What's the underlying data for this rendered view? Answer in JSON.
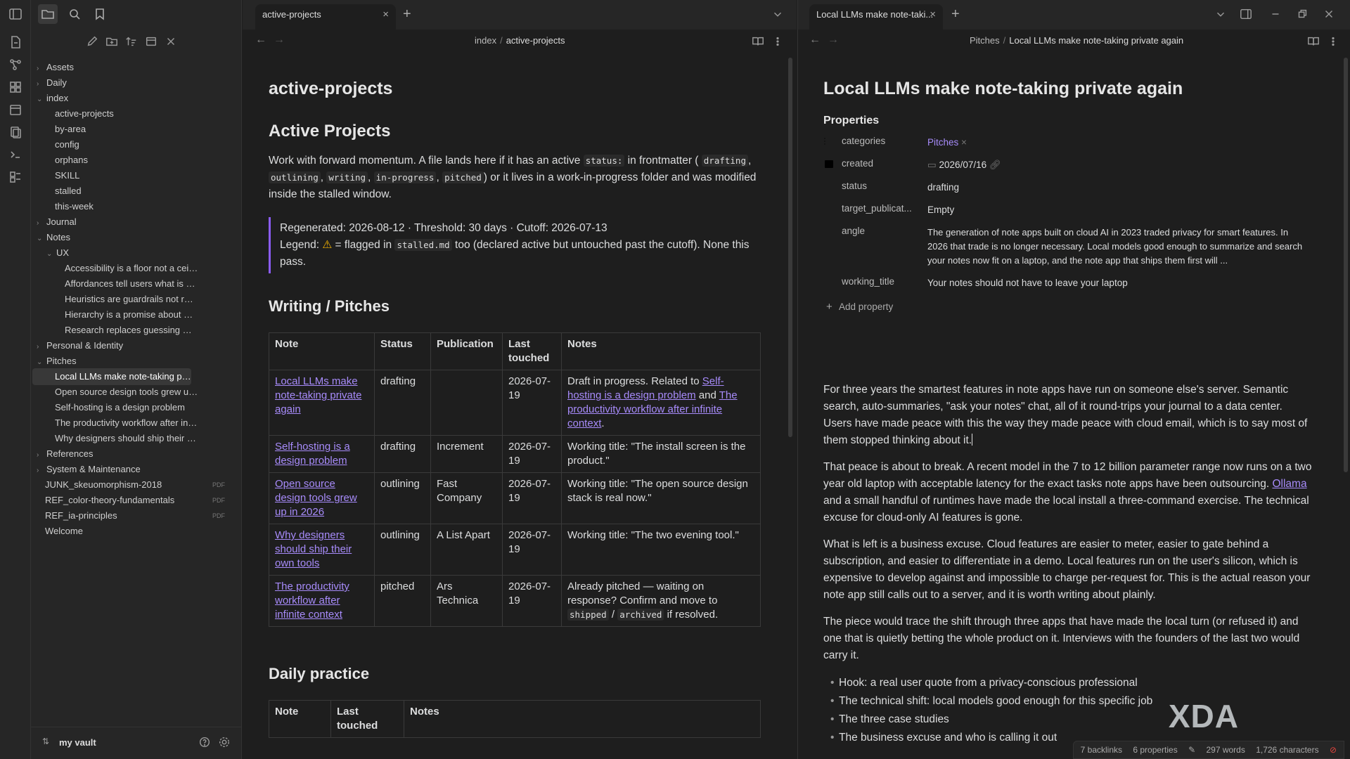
{
  "sidebar": {
    "tree": [
      {
        "label": "Assets",
        "kind": "folder",
        "open": false,
        "level": 0
      },
      {
        "label": "Daily",
        "kind": "folder",
        "open": false,
        "level": 0
      },
      {
        "label": "index",
        "kind": "folder",
        "open": true,
        "level": 0
      },
      {
        "label": "active-projects",
        "kind": "file",
        "level": 1
      },
      {
        "label": "by-area",
        "kind": "file",
        "level": 1
      },
      {
        "label": "config",
        "kind": "file",
        "level": 1
      },
      {
        "label": "orphans",
        "kind": "file",
        "level": 1
      },
      {
        "label": "SKILL",
        "kind": "file",
        "level": 1
      },
      {
        "label": "stalled",
        "kind": "file",
        "level": 1
      },
      {
        "label": "this-week",
        "kind": "file",
        "level": 1
      },
      {
        "label": "Journal",
        "kind": "folder",
        "open": false,
        "level": 0
      },
      {
        "label": "Notes",
        "kind": "folder",
        "open": true,
        "level": 0
      },
      {
        "label": "UX",
        "kind": "folder",
        "open": true,
        "level": 1
      },
      {
        "label": "Accessibility is a floor not a ceiling",
        "kind": "file",
        "level": 2
      },
      {
        "label": "Affordances tell users what is possi...",
        "kind": "file",
        "level": 2
      },
      {
        "label": "Heuristics are guardrails not rules",
        "kind": "file",
        "level": 2
      },
      {
        "label": "Hierarchy is a promise about what ...",
        "kind": "file",
        "level": 2
      },
      {
        "label": "Research replaces guessing with wi...",
        "kind": "file",
        "level": 2
      },
      {
        "label": "Personal & Identity",
        "kind": "folder",
        "open": false,
        "level": 0
      },
      {
        "label": "Pitches",
        "kind": "folder",
        "open": true,
        "level": 0
      },
      {
        "label": "Local LLMs make note-taking private ...",
        "kind": "file",
        "level": 1,
        "selected": true
      },
      {
        "label": "Open source design tools grew up in ...",
        "kind": "file",
        "level": 1
      },
      {
        "label": "Self-hosting is a design problem",
        "kind": "file",
        "level": 1
      },
      {
        "label": "The productivity workflow after infinit...",
        "kind": "file",
        "level": 1
      },
      {
        "label": "Why designers should ship their own ...",
        "kind": "file",
        "level": 1
      },
      {
        "label": "References",
        "kind": "folder",
        "open": false,
        "level": 0
      },
      {
        "label": "System & Maintenance",
        "kind": "folder",
        "open": false,
        "level": 0
      },
      {
        "label": "JUNK_skeuomorphism-2018",
        "kind": "file",
        "level": 0,
        "badge": "PDF"
      },
      {
        "label": "REF_color-theory-fundamentals",
        "kind": "file",
        "level": 0,
        "badge": "PDF"
      },
      {
        "label": "REF_ia-principles",
        "kind": "file",
        "level": 0,
        "badge": "PDF"
      },
      {
        "label": "Welcome",
        "kind": "file",
        "level": 0
      }
    ],
    "vault_name": "my vault"
  },
  "left_pane": {
    "tab_label": "active-projects",
    "breadcrumb": [
      "index",
      "active-projects"
    ],
    "inline_title": "active-projects",
    "h1": "Active Projects",
    "intro": {
      "t1": "Work with forward momentum. A file lands here if it has an active ",
      "c1": "status:",
      "t2": " in frontmatter (",
      "c2": "drafting",
      "c3": "outlining",
      "c4": "writing",
      "c5": "in-progress",
      "c6": "pitched",
      "t3": ") or it lives in a work-in-progress folder and was modified inside the stalled window."
    },
    "callout": {
      "line1": "Regenerated: 2026-08-12 · Threshold: 30 days · Cutoff: 2026-07-13",
      "legend_a": "Legend: ",
      "legend_b": " = flagged in ",
      "legend_code": "stalled.md",
      "legend_c": " too (declared active but untouched past the cutoff). None this pass."
    },
    "h2_writing": "Writing / Pitches",
    "table_headers": [
      "Note",
      "Status",
      "Publication",
      "Last touched",
      "Notes"
    ],
    "rows": [
      {
        "note": "Local LLMs make note-taking private again",
        "status": "drafting",
        "pub": "",
        "last": "2026-07-19",
        "notes_a": "Draft in progress. Related to ",
        "link1": "Self-hosting is a design problem",
        "notes_b": " and ",
        "link2": "The productivity workflow after infinite context",
        "notes_c": "."
      },
      {
        "note": "Self-hosting is a design problem",
        "status": "drafting",
        "pub": "Increment",
        "last": "2026-07-19",
        "notes": "Working title: \"The install screen is the product.\""
      },
      {
        "note": "Open source design tools grew up in 2026",
        "status": "outlining",
        "pub": "Fast Company",
        "last": "2026-07-19",
        "notes": "Working title: \"The open source design stack is real now.\""
      },
      {
        "note": "Why designers should ship their own tools",
        "status": "outlining",
        "pub": "A List Apart",
        "last": "2026-07-19",
        "notes": "Working title: \"The two evening tool.\""
      },
      {
        "note": "The productivity workflow after infinite context",
        "status": "pitched",
        "pub": "Ars Technica",
        "last": "2026-07-19",
        "notes_a": "Already pitched — waiting on response? Confirm and move to ",
        "code1": "shipped",
        "notes_b": " / ",
        "code2": "archived",
        "notes_c": " if resolved."
      }
    ],
    "h2_daily": "Daily practice",
    "daily_headers": [
      "Note",
      "Last touched",
      "Notes"
    ]
  },
  "right_pane": {
    "tab_label": "Local LLMs make note-taki...",
    "breadcrumb": [
      "Pitches",
      "Local LLMs make note-taking private again"
    ],
    "inline_title": "Local LLMs make note-taking private again",
    "properties_heading": "Properties",
    "properties": [
      {
        "name": "categories",
        "value": "Pitches",
        "icon": "list-icon"
      },
      {
        "name": "created",
        "value": "2026/07/16",
        "icon": "calendar-icon"
      },
      {
        "name": "status",
        "value": "drafting",
        "icon": "text-icon"
      },
      {
        "name": "target_publicat...",
        "value": "Empty",
        "icon": "text-icon"
      },
      {
        "name": "angle",
        "value": "The generation of note apps built on cloud AI in 2023 traded privacy for smart features. In 2026 that trade is no longer necessary. Local models good enough to summarize and search your notes now fit on a laptop, and the note app that ships them first will ...",
        "icon": "text-icon"
      },
      {
        "name": "working_title",
        "value": "Your notes should not have to leave your laptop",
        "icon": "text-icon"
      }
    ],
    "add_property": "Add property",
    "paragraphs": {
      "p1": "For three years the smartest features in note apps have run on someone else's server. Semantic search, auto-summaries, \"ask your notes\" chat, all of it round-trips your journal to a data center. Users have made peace with this the way they made peace with cloud email, which is to say most of them stopped thinking about it.",
      "p2a": "That peace is about to break. A recent model in the 7 to 12 billion parameter range now runs on a two year old laptop with acceptable latency for the exact tasks note apps have been outsourcing. ",
      "p2link": "Ollama",
      "p2b": " and a small handful of runtimes have made the local install a three-command exercise. The technical excuse for cloud-only AI features is gone.",
      "p3": "What is left is a business excuse. Cloud features are easier to meter, easier to gate behind a subscription, and easier to differentiate in a demo. Local features run on the user's silicon, which is expensive to develop against and impossible to charge per-request for. This is the actual reason your note app still calls out to a server, and it is worth writing about plainly.",
      "p4": "The piece would trace the shift through three apps that have made the local turn (or refused it) and one that is quietly betting the whole product on it. Interviews with the founders of the last two would carry it."
    },
    "bullets": [
      "Hook: a real user quote from a privacy-conscious professional",
      "The technical shift: local models good enough for this specific job",
      "The three case studies",
      "The business excuse and who is calling it out"
    ]
  },
  "status_bar": {
    "backlinks": "7 backlinks",
    "properties": "6 properties",
    "words": "297 words",
    "characters": "1,726 characters"
  },
  "watermark": "XDA",
  "colors": {
    "accent": "#8b5cf6",
    "link": "#a78bfa",
    "background": "#1e1e1e",
    "sidebar": "#262626"
  }
}
